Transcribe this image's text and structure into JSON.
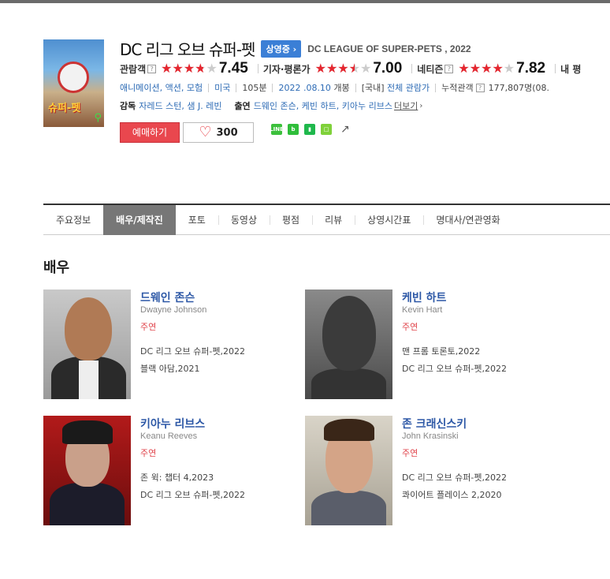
{
  "movie": {
    "title_ko": "DC 리그 오브 슈퍼-펫",
    "status_badge": "상영중",
    "title_en": "DC LEAGUE OF SUPER-PETS , 2022",
    "poster_title": "슈퍼-펫"
  },
  "ratings": [
    {
      "label": "관람객",
      "score": "7.45",
      "fraction": 0.745
    },
    {
      "label": "기자·평론가",
      "score": "7.00",
      "fraction": 0.7
    },
    {
      "label": "네티즌",
      "score": "7.82",
      "fraction": 0.782
    },
    {
      "label": "내 평"
    }
  ],
  "meta": {
    "genre": "애니메이션, 액션, 모험",
    "country": "미국",
    "runtime": "105분",
    "release_date": "2022 .08.10",
    "release_suffix": "개봉",
    "rating_prefix": "[국내]",
    "rating": "전체 관람가",
    "audience_label": "누적관객",
    "audience_value": "177,807명(08."
  },
  "credits": {
    "director_label": "감독",
    "directors": "자레드 스턴, 샘 J. 레빈",
    "cast_label": "출연",
    "cast": "드웨인 존슨, 케빈 하트, 키아누 리브스",
    "more": "더보기"
  },
  "actions": {
    "reserve": "예매하기",
    "likes": "300"
  },
  "tabs": [
    "주요정보",
    "배우/제작진",
    "포토",
    "동영상",
    "평점",
    "리뷰",
    "상영시간표",
    "명대사/연관영화"
  ],
  "active_tab": "배우/제작진",
  "section_title": "배우",
  "actors": [
    {
      "name": "드웨인 존슨",
      "name_en": "Dwayne Johnson",
      "role": "주연",
      "films": [
        "DC 리그 오브 슈퍼-펫,2022",
        "블랙 아담,2021"
      ]
    },
    {
      "name": "케빈 하트",
      "name_en": "Kevin Hart",
      "role": "주연",
      "films": [
        "맨 프롬 토론토,2022",
        "DC 리그 오브 슈퍼-펫,2022"
      ]
    },
    {
      "name": "키아누 리브스",
      "name_en": "Keanu Reeves",
      "role": "주연",
      "films": [
        "존 윅: 챕터 4,2023",
        "DC 리그 오브 슈퍼-펫,2022"
      ]
    },
    {
      "name": "존 크래신스키",
      "name_en": "John Krasinski",
      "role": "주연",
      "films": [
        "DC 리그 오브 슈퍼-펫,2022",
        "콰이어트 플레이스 2,2020"
      ]
    }
  ],
  "colors": {
    "accent_red": "#e9474e",
    "link_blue": "#2d6bb5",
    "badge_blue": "#3b7fd6",
    "star_red": "#e5262f"
  }
}
